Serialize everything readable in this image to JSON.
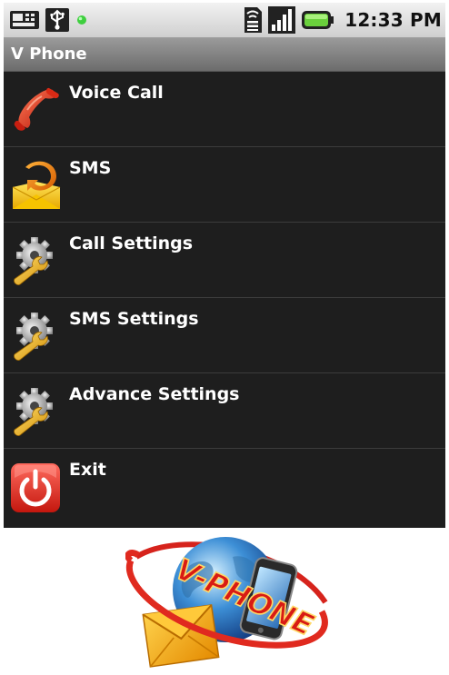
{
  "status_bar": {
    "time": "12:33 PM",
    "icons": [
      "keyboard-icon",
      "usb-icon",
      "notification-led-icon",
      "sim-icon",
      "signal-icon",
      "battery-icon"
    ]
  },
  "app": {
    "title": "V Phone"
  },
  "menu": {
    "items": [
      {
        "label": "Voice Call",
        "icon": "phone-handset-icon"
      },
      {
        "label": "SMS",
        "icon": "sms-envelope-icon"
      },
      {
        "label": "Call Settings",
        "icon": "settings-gear-wrench-icon"
      },
      {
        "label": "SMS Settings",
        "icon": "settings-gear-wrench-icon"
      },
      {
        "label": "Advance Settings",
        "icon": "settings-gear-wrench-icon"
      },
      {
        "label": "Exit",
        "icon": "power-icon"
      }
    ]
  },
  "logo": {
    "text": "V-PHONE"
  },
  "colors": {
    "menu_background": "#1e1e1e",
    "title_bar": "#7d7d7d",
    "status_bar": "#e0e0e0",
    "exit_red": "#e0312a",
    "phone_red": "#e0331f"
  }
}
